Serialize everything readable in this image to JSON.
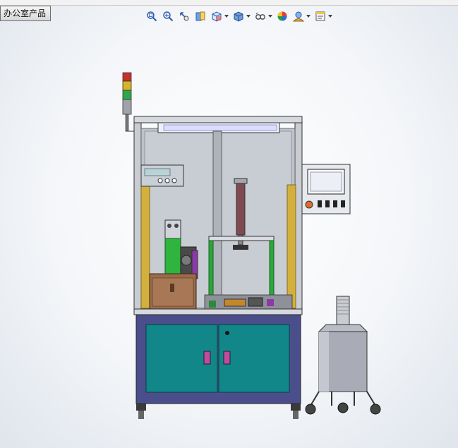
{
  "tab": {
    "label": "办公室产品"
  },
  "toolbar": {
    "buttons": [
      {
        "name": "zoom-to-fit-icon",
        "dropdown": false
      },
      {
        "name": "zoom-to-area-icon",
        "dropdown": false
      },
      {
        "name": "previous-view-icon",
        "dropdown": false
      },
      {
        "name": "section-view-icon",
        "dropdown": false
      },
      {
        "name": "view-orientation-icon",
        "dropdown": true
      },
      {
        "name": "display-style-icon",
        "dropdown": true
      },
      {
        "name": "hide-show-items-icon",
        "dropdown": true
      },
      {
        "name": "edit-appearance-icon",
        "dropdown": false
      },
      {
        "name": "apply-scene-icon",
        "dropdown": true
      },
      {
        "name": "view-settings-icon",
        "dropdown": true
      }
    ]
  },
  "colors": {
    "frame": "#c7ccd3",
    "cabinet_body": "#4a4f8c",
    "cabinet_door": "#11878a",
    "wood_box": "#9a6a4a",
    "yellow_strip": "#d8b53a",
    "green_part": "#26b33a",
    "tank": "#a9acb7"
  }
}
